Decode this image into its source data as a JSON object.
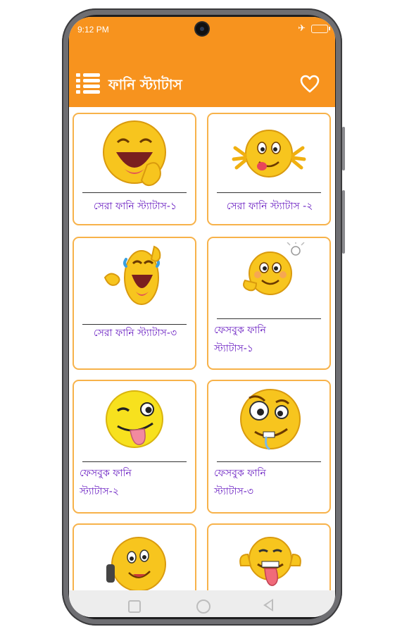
{
  "status_bar": {
    "time": "9:12 PM"
  },
  "app_bar": {
    "title": "ফানি স্ট্যাটাস"
  },
  "cards": [
    {
      "label": "সেরা ফানি স্ট্যাটাস-১",
      "icon": "laughing-emoji-icon"
    },
    {
      "label": "সেরা ফানি স্ট্যাটাস -২",
      "icon": "silly-tongue-emoji-icon"
    },
    {
      "label": "সেরা ফানি স্ট্যাটাস-৩",
      "icon": "crying-laughing-emoji-icon"
    },
    {
      "label": "ফেসবুক ফানি স্ট্যাটাস-১",
      "icon": "idea-emoji-icon"
    },
    {
      "label": "ফেসবুক ফানি স্ট্যাটাস-২",
      "icon": "winking-tongue-emoji-icon"
    },
    {
      "label": "ফেসবুক ফানি স্ট্যাটাস-৩",
      "icon": "crazy-drooling-emoji-icon"
    },
    {
      "label": "",
      "icon": "phone-call-emoji-icon"
    },
    {
      "label": "",
      "icon": "thumbs-up-tongue-emoji-icon"
    }
  ],
  "colors": {
    "accent": "#f7931e",
    "card_border": "#f7b24a",
    "label": "#6a1fc2",
    "emoji": "#f7c51e"
  }
}
